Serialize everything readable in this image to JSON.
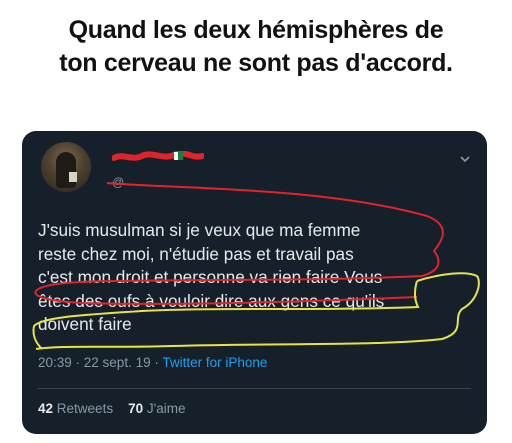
{
  "caption": {
    "line1": "Quand les deux hémisphères de",
    "line2": "ton cerveau ne sont pas d'accord."
  },
  "tweet": {
    "handle": "@",
    "lines": [
      "J'suis musulman si je veux que ma femme",
      "reste chez moi, n'étudie pas et travail pas",
      "c'est mon droit et personne va rien faire",
      "Vous",
      "êtes des oufs à vouloir dire aux gens ce qu'ils",
      "doivent faire"
    ],
    "time": "20:39 · 22 sept. 19 ·",
    "source": "Twitter for iPhone",
    "retweets_count": "42",
    "retweets_label": "Retweets",
    "likes_count": "70",
    "likes_label": "J'aime"
  },
  "icons": {
    "menu": "chevron-down-icon",
    "avatar": "avatar"
  },
  "colors": {
    "card_bg": "#15202b",
    "text": "#e7e9ea",
    "muted": "#8899a6",
    "link": "#1da1f2",
    "red_scribble": "#e0242c",
    "yellow_scribble": "#e8e24a"
  }
}
